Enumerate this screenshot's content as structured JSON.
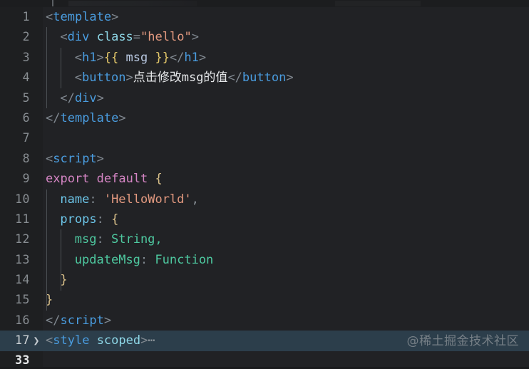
{
  "editor": {
    "app": "code-editor",
    "theme_colors": {
      "background": "#212225",
      "gutter_background": "#1e1f21",
      "folded_line_highlight": "#2c3e4b",
      "line_number": "#888d92",
      "tag": "#4a9de0",
      "attribute": "#8fd8e8",
      "string": "#e49a80",
      "keyword": "#d585c4",
      "brace": "#d9c08a",
      "property": "#6cc5e8",
      "type": "#4ec9a0",
      "punctuation": "#808890",
      "plain_text": "#e6e8ea",
      "mustache": "#e4c86a"
    },
    "fold_arrow_glyph": "❯",
    "folded_ellipsis": "⋯",
    "lines": [
      {
        "number": "1",
        "indent": 0,
        "tokens": [
          {
            "text": "<",
            "type": "punct"
          },
          {
            "text": "template",
            "type": "tag"
          },
          {
            "text": ">",
            "type": "punct"
          }
        ]
      },
      {
        "number": "2",
        "indent": 1,
        "tokens": [
          {
            "text": "<",
            "type": "punct"
          },
          {
            "text": "div",
            "type": "tag"
          },
          {
            "text": " ",
            "type": "punct"
          },
          {
            "text": "class",
            "type": "attr"
          },
          {
            "text": "=",
            "type": "punct"
          },
          {
            "text": "\"hello\"",
            "type": "string"
          },
          {
            "text": ">",
            "type": "punct"
          }
        ]
      },
      {
        "number": "3",
        "indent": 2,
        "tokens": [
          {
            "text": "<",
            "type": "punct"
          },
          {
            "text": "h1",
            "type": "tag"
          },
          {
            "text": ">",
            "type": "punct"
          },
          {
            "text": "{{",
            "type": "mustache"
          },
          {
            "text": " msg ",
            "type": "interp"
          },
          {
            "text": "}}",
            "type": "mustache"
          },
          {
            "text": "</",
            "type": "punct"
          },
          {
            "text": "h1",
            "type": "tag"
          },
          {
            "text": ">",
            "type": "punct"
          }
        ]
      },
      {
        "number": "4",
        "indent": 2,
        "tokens": [
          {
            "text": "<",
            "type": "punct"
          },
          {
            "text": "button",
            "type": "tag"
          },
          {
            "text": ">",
            "type": "punct"
          },
          {
            "text": "点击修改msg的值",
            "type": "text"
          },
          {
            "text": "</",
            "type": "punct"
          },
          {
            "text": "button",
            "type": "tag"
          },
          {
            "text": ">",
            "type": "punct"
          }
        ]
      },
      {
        "number": "5",
        "indent": 1,
        "tokens": [
          {
            "text": "</",
            "type": "punct"
          },
          {
            "text": "div",
            "type": "tag"
          },
          {
            "text": ">",
            "type": "punct"
          }
        ]
      },
      {
        "number": "6",
        "indent": 0,
        "tokens": [
          {
            "text": "</",
            "type": "punct"
          },
          {
            "text": "template",
            "type": "tag"
          },
          {
            "text": ">",
            "type": "punct"
          }
        ]
      },
      {
        "number": "7",
        "indent": 0,
        "tokens": []
      },
      {
        "number": "8",
        "indent": 0,
        "tokens": [
          {
            "text": "<",
            "type": "punct"
          },
          {
            "text": "script",
            "type": "tag"
          },
          {
            "text": ">",
            "type": "punct"
          }
        ]
      },
      {
        "number": "9",
        "indent": 0,
        "tokens": [
          {
            "text": "export default ",
            "type": "kw"
          },
          {
            "text": "{",
            "type": "brace"
          }
        ]
      },
      {
        "number": "10",
        "indent": 1,
        "tokens": [
          {
            "text": "name",
            "type": "prop"
          },
          {
            "text": ": ",
            "type": "punct"
          },
          {
            "text": "'HelloWorld'",
            "type": "string"
          },
          {
            "text": ",",
            "type": "comma"
          }
        ]
      },
      {
        "number": "11",
        "indent": 1,
        "tokens": [
          {
            "text": "props",
            "type": "prop"
          },
          {
            "text": ": ",
            "type": "punct"
          },
          {
            "text": "{",
            "type": "brace"
          }
        ]
      },
      {
        "number": "12",
        "indent": 2,
        "tokens": [
          {
            "text": "msg",
            "type": "green"
          },
          {
            "text": ": ",
            "type": "punct"
          },
          {
            "text": "String",
            "type": "green"
          },
          {
            "text": ",",
            "type": "green"
          }
        ]
      },
      {
        "number": "13",
        "indent": 2,
        "tokens": [
          {
            "text": "updateMsg",
            "type": "green"
          },
          {
            "text": ": ",
            "type": "punct"
          },
          {
            "text": "Function",
            "type": "green"
          }
        ]
      },
      {
        "number": "14",
        "indent": 1,
        "tokens": [
          {
            "text": "}",
            "type": "brace"
          }
        ]
      },
      {
        "number": "15",
        "indent": 0,
        "tokens": [
          {
            "text": "}",
            "type": "brace"
          }
        ]
      },
      {
        "number": "16",
        "indent": 0,
        "tokens": [
          {
            "text": "</",
            "type": "punct"
          },
          {
            "text": "script",
            "type": "tag"
          },
          {
            "text": ">",
            "type": "punct"
          }
        ]
      },
      {
        "number": "17",
        "indent": 0,
        "folded": true,
        "fold_arrow": "❯",
        "tokens": [
          {
            "text": "<",
            "type": "punct"
          },
          {
            "text": "style",
            "type": "tag"
          },
          {
            "text": " ",
            "type": "punct"
          },
          {
            "text": "scoped",
            "type": "attr"
          },
          {
            "text": ">",
            "type": "punct"
          },
          {
            "text": "⋯",
            "type": "ellipsis"
          }
        ]
      },
      {
        "number": "33",
        "indent": 0,
        "last": true,
        "tokens": []
      }
    ]
  },
  "watermark": {
    "text": "@稀土掘金技术社区"
  }
}
